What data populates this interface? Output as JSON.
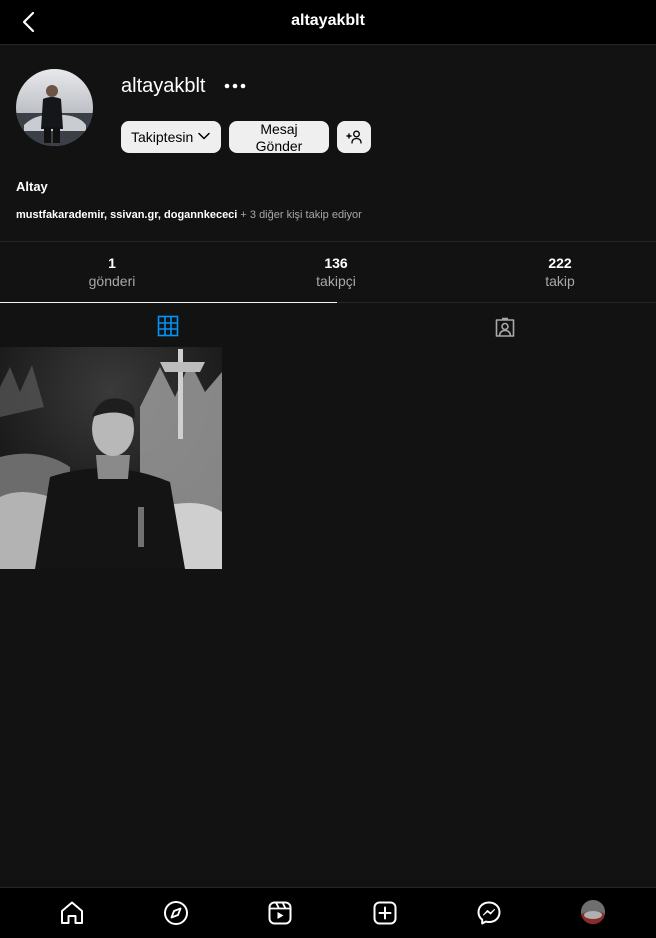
{
  "header": {
    "title": "altayakblt"
  },
  "profile": {
    "username": "altayakblt",
    "full_name": "Altay",
    "follow_label": "Takiptesin",
    "message_label_line1": "Mesaj",
    "message_label_line2": "Gönder",
    "followed_by": {
      "user1": "mustfakarademir",
      "sep1": ", ",
      "user2": "ssivan.gr",
      "sep2": ", ",
      "user3": "dogannkececi",
      "more": " + 3 diğer kişi takip ediyor"
    }
  },
  "stats": [
    {
      "value": "1",
      "label": "gönderi"
    },
    {
      "value": "136",
      "label": "takipçi"
    },
    {
      "value": "222",
      "label": "takip"
    }
  ],
  "tabs": [
    {
      "icon": "grid-icon",
      "active": true
    },
    {
      "icon": "tagged-icon",
      "active": false
    }
  ],
  "colors": {
    "accent": "#0095f6",
    "background": "#121212",
    "bar": "#000000"
  },
  "bottom_nav": [
    "home-icon",
    "explore-icon",
    "reels-icon",
    "new-post-icon",
    "messenger-icon",
    "profile-avatar"
  ]
}
